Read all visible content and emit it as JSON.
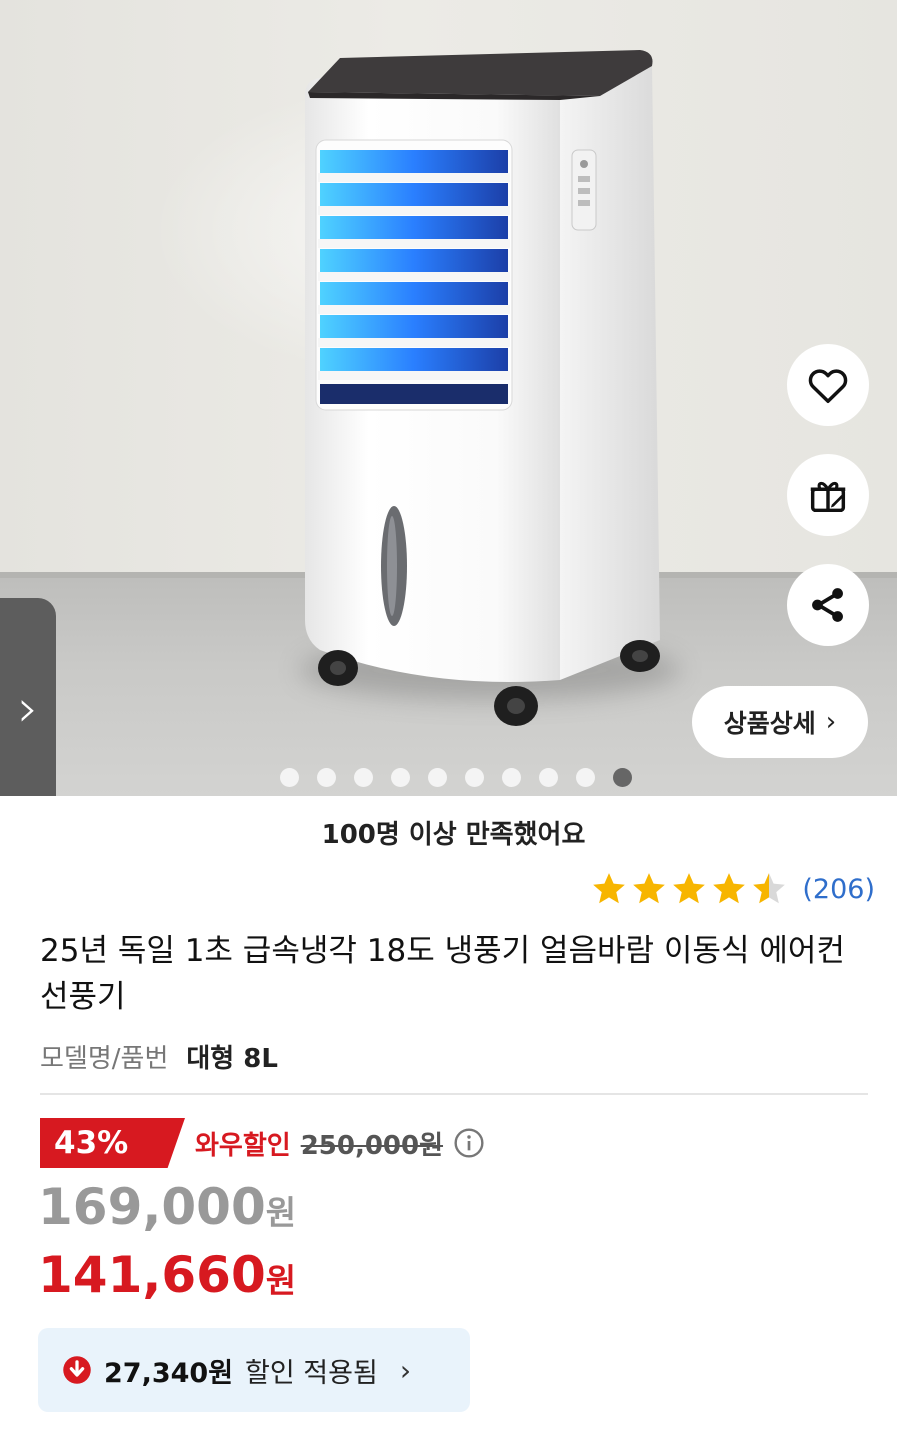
{
  "product": {
    "title": "25년 독일 1초 급속냉각 18도 냉풍기 얼음바람 이동식 에어컨 선풍기",
    "satisfaction": "100명 이상 만족했어요",
    "rating_value": 4.5,
    "review_count": "(206)",
    "model_label": "모델명/품번",
    "model_value": "대형 8L"
  },
  "gallery": {
    "side_arrow": "›",
    "detail_button": "상품상세",
    "detail_chevron": "›",
    "total_images": 10,
    "active_index": 9,
    "actions": [
      "heart-icon",
      "gift-icon",
      "share-icon"
    ]
  },
  "pricing": {
    "discount_percent": "43%",
    "promo_label": "와우할인",
    "original_price": "250,000원",
    "sale_price": "169,000",
    "sale_unit": "원",
    "final_price": "141,660",
    "final_unit": "원",
    "applied_amount": "27,340원",
    "applied_text": "할인 적용됨",
    "applied_chevron": "›"
  },
  "colors": {
    "accent_red": "#d71920",
    "star_yellow": "#f7b500",
    "link_blue": "#2f6ecb",
    "applied_bg": "#e9f3fb"
  }
}
